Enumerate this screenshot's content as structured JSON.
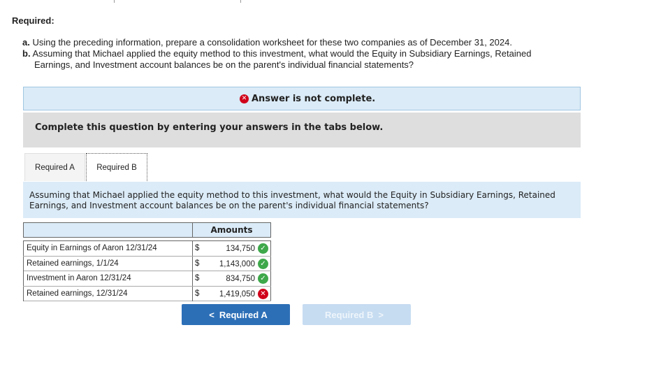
{
  "required_heading": "Required:",
  "instructions": {
    "a_prefix": "a.",
    "a_text": "Using the preceding information, prepare a consolidation worksheet for these two companies as of December 31, 2024.",
    "b_prefix": "b.",
    "b_text_line1": "Assuming that Michael applied the equity method to this investment, what would the Equity in Subsidiary Earnings, Retained",
    "b_text_line2": "Earnings, and Investment account balances be on the parent's individual financial statements?"
  },
  "banner": {
    "text": "Answer is not complete.",
    "icon": "x-circle-icon"
  },
  "complete_prompt": "Complete this question by entering your answers in the tabs below.",
  "tabs": [
    {
      "label": "Required A",
      "active": false
    },
    {
      "label": "Required B",
      "active": true
    }
  ],
  "question": {
    "line1": "Assuming that Michael applied the equity method to this investment, what would the Equity in Subsidiary Earnings, Retained",
    "line2": "Earnings, and Investment account balances be on the parent's individual financial statements?"
  },
  "table": {
    "column_header": "Amounts",
    "rows": [
      {
        "label": "Equity in Earnings of Aaron 12/31/24",
        "currency": "$",
        "value": "134,750",
        "status": "correct"
      },
      {
        "label": "Retained earnings, 1/1/24",
        "currency": "$",
        "value": "1,143,000",
        "status": "correct"
      },
      {
        "label": "Investment in Aaron 12/31/24",
        "currency": "$",
        "value": "834,750",
        "status": "correct"
      },
      {
        "label": "Retained earnings, 12/31/24",
        "currency": "$",
        "value": "1,419,050",
        "status": "incorrect"
      }
    ]
  },
  "nav": {
    "prev_label": "Required A",
    "next_label": "Required B",
    "prev_icon": "chevron-left-icon",
    "next_icon": "chevron-right-icon"
  },
  "colors": {
    "correct": "#3ea84a",
    "incorrect": "#d0021b",
    "primary_button": "#2d6fb7",
    "disabled_button": "#c6dcf1",
    "info_bg": "#dbebf7"
  }
}
